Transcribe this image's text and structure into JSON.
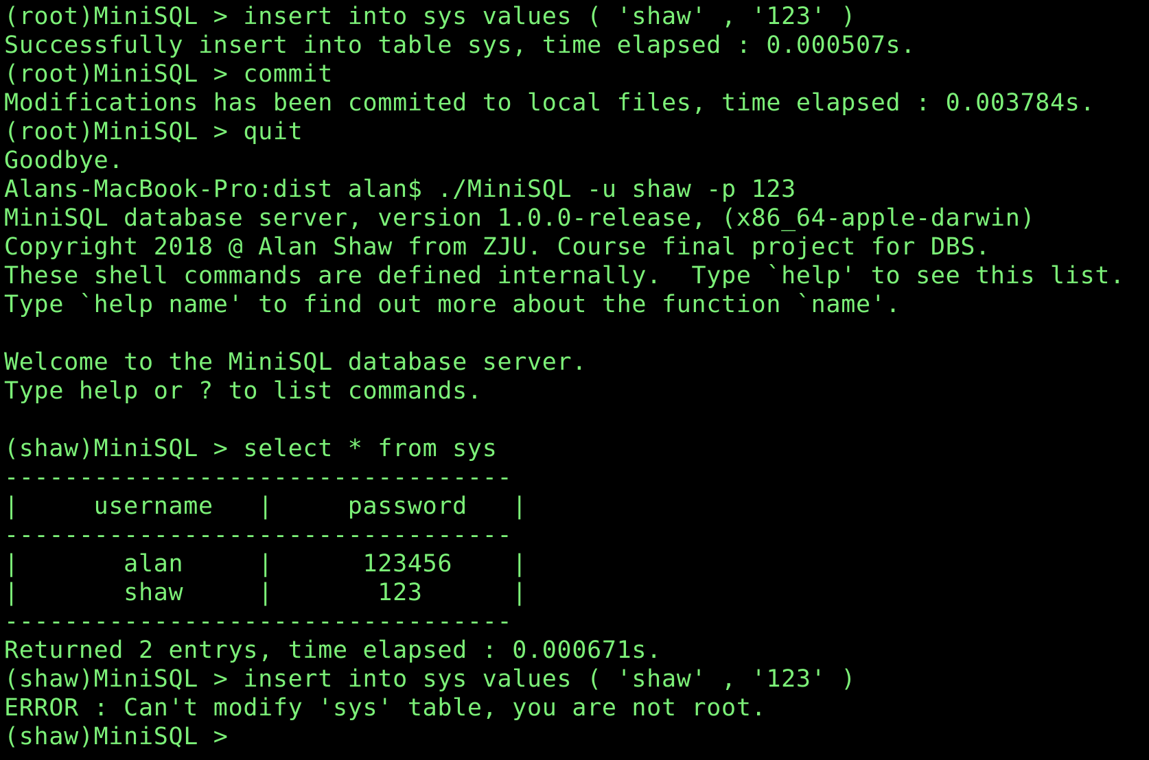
{
  "terminal": {
    "colors": {
      "background": "#000000",
      "text": "#7CF078"
    },
    "lines": [
      "(root)MiniSQL > insert into sys values ( 'shaw' , '123' )",
      "Successfully insert into table sys, time elapsed : 0.000507s.",
      "(root)MiniSQL > commit",
      "Modifications has been commited to local files, time elapsed : 0.003784s.",
      "(root)MiniSQL > quit",
      "Goodbye.",
      "Alans-MacBook-Pro:dist alan$ ./MiniSQL -u shaw -p 123",
      "MiniSQL database server, version 1.0.0-release, (x86_64-apple-darwin)",
      "Copyright 2018 @ Alan Shaw from ZJU. Course final project for DBS.",
      "These shell commands are defined internally.  Type `help' to see this list.",
      "Type `help name' to find out more about the function `name'.",
      "",
      "Welcome to the MiniSQL database server.",
      "Type help or ? to list commands.",
      "",
      "(shaw)MiniSQL > select * from sys",
      "----------------------------------",
      "|     username   |     password   |",
      "----------------------------------",
      "|       alan     |      123456    |",
      "|       shaw     |       123      |",
      "----------------------------------",
      "Returned 2 entrys, time elapsed : 0.000671s.",
      "(shaw)MiniSQL > insert into sys values ( 'shaw' , '123' )",
      "ERROR : Can't modify 'sys' table, you are not root.",
      "(shaw)MiniSQL > "
    ]
  }
}
